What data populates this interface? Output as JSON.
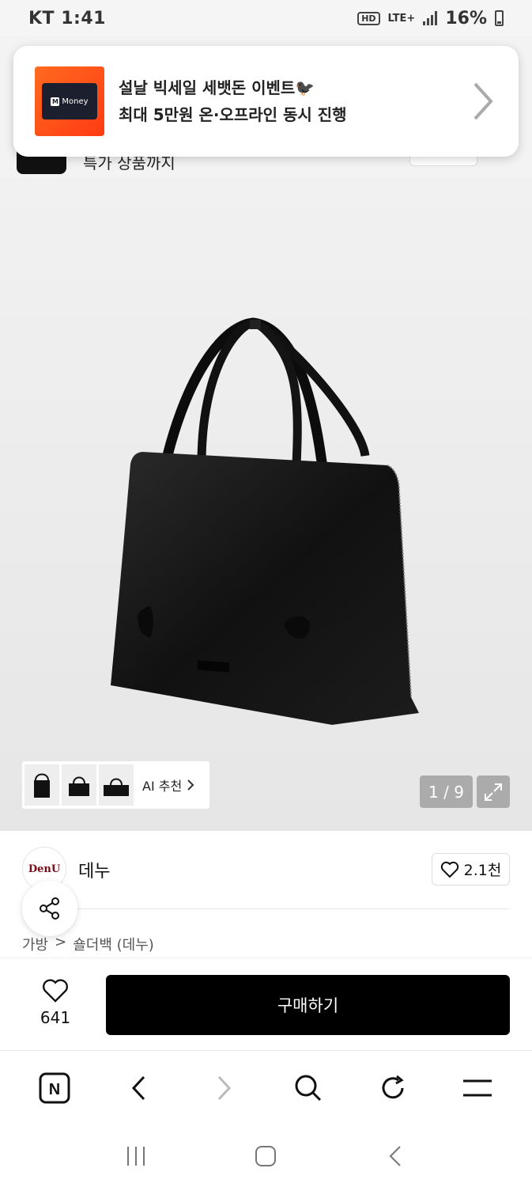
{
  "status": {
    "carrier_time": "KT 1:41",
    "hd": "HD",
    "network": "LTE+",
    "battery": "16%"
  },
  "page": {
    "header_text": "특가 상품까지"
  },
  "notification": {
    "card_text": "Money",
    "title": "설날 빅세일 세뱃돈 이벤트🐦‍⬛",
    "subtitle": "최대 5만원 온·오프라인 동시 진행"
  },
  "gallery": {
    "ai_label": "AI 추천",
    "counter": "1 / 9"
  },
  "brand": {
    "logo_text": "DenU",
    "name": "데누",
    "likes": "2.1천"
  },
  "breadcrumb": {
    "category": "가방",
    "separator": ">",
    "subcategory": "숄더백 (데누)"
  },
  "purchase": {
    "wish_count": "641",
    "buy_label": "구매하기"
  },
  "browser": {
    "home_letter": "N"
  }
}
